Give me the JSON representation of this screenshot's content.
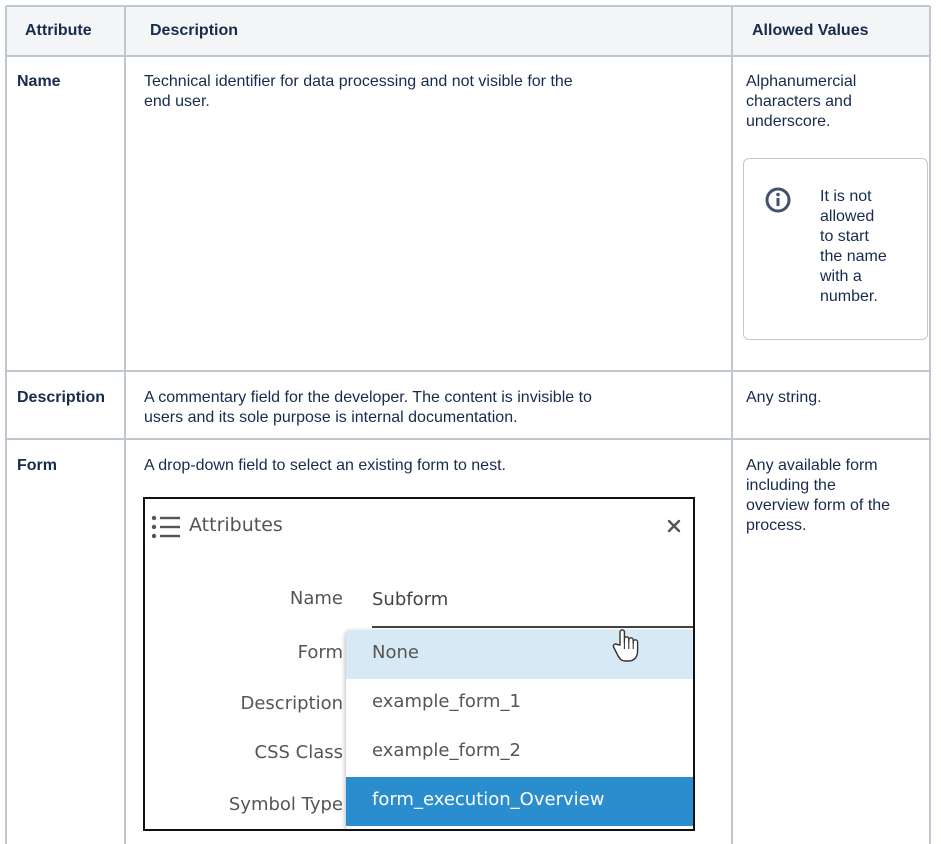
{
  "table": {
    "headers": [
      "Attribute",
      "Description",
      "Allowed Values"
    ],
    "rows": [
      {
        "attribute": "Name",
        "description_lines": [
          "Technical identifier for data processing and not visible for the",
          "end user."
        ],
        "allowed_lines": [
          "Alphanumercial",
          "characters and",
          "underscore."
        ],
        "info_note_lines": [
          "It is not",
          "allowed",
          "to start",
          "the name",
          "with a",
          "number."
        ]
      },
      {
        "attribute": "Description",
        "description_lines": [
          "A commentary field for the developer. The content is invisible to",
          "users and its sole purpose is internal documentation."
        ],
        "allowed_lines": [
          "Any string."
        ]
      },
      {
        "attribute": "Form",
        "description_lines": [
          "A drop-down field to select an existing form to nest."
        ],
        "allowed_lines": [
          "Any available form",
          "including the",
          "overview form of the",
          "process."
        ]
      }
    ]
  },
  "screenshot": {
    "title": "Attributes",
    "field_labels": [
      "Name",
      "Form",
      "Description",
      "CSS Class",
      "Symbol Type"
    ],
    "name_value": "Subform",
    "options": [
      "None",
      "example_form_1",
      "example_form_2",
      "form_execution_Overview"
    ],
    "hovered_option": 0,
    "selected_option": 3
  },
  "colors": {
    "border": "#c1c7d0",
    "header_bg": "#f4f5f7",
    "hover_bg": "#d6e9f5",
    "selected_bg": "#2a8dcd",
    "info_icon": "#42526e"
  },
  "icons": [
    "info-icon",
    "list-icon",
    "close-icon",
    "hand-cursor-icon"
  ]
}
